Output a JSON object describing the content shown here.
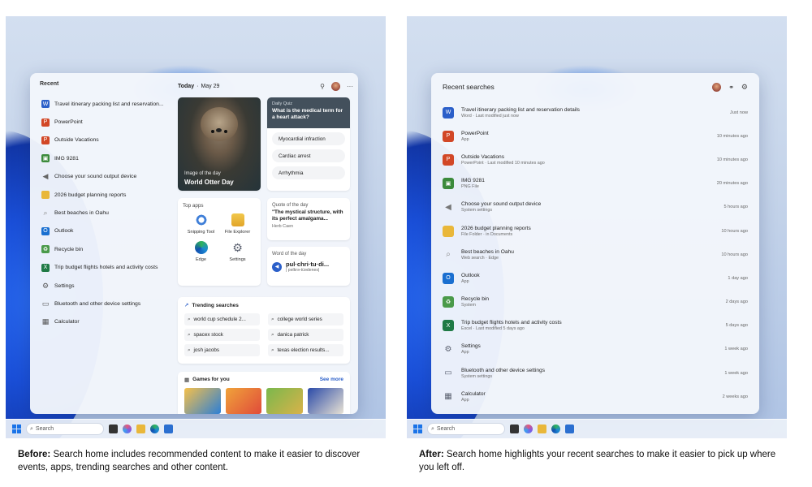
{
  "left": {
    "taskbar_search": "Search",
    "recent_header": "Recent",
    "recent": [
      {
        "label": "Travel itinerary packing list and reservation...",
        "icon": "word-icon",
        "color": "#2b5fc9"
      },
      {
        "label": "PowerPoint",
        "icon": "powerpoint-icon",
        "color": "#d24726"
      },
      {
        "label": "Outside Vacations",
        "icon": "powerpoint-file-icon",
        "color": "#d24726"
      },
      {
        "label": "IMG 9281",
        "icon": "image-thumbnail-icon",
        "color": "#3b8a3b"
      },
      {
        "label": "Choose your sound output device",
        "icon": "speaker-icon",
        "color": "#666666"
      },
      {
        "label": "2026 budget planning reports",
        "icon": "folder-icon",
        "color": "#e9b73a"
      },
      {
        "label": "Best beaches in Oahu",
        "icon": "search-icon",
        "color": "#888888"
      },
      {
        "label": "Outlook",
        "icon": "outlook-icon",
        "color": "#1a6fd0"
      },
      {
        "label": "Recycle bin",
        "icon": "recycle-bin-icon",
        "color": "#4a9a4a"
      },
      {
        "label": "Trip budget flights hotels and activity costs",
        "icon": "excel-icon",
        "color": "#1f7a45"
      },
      {
        "label": "Settings",
        "icon": "settings-icon",
        "color": "#555555"
      },
      {
        "label": "Bluetooth and other device settings",
        "icon": "bluetooth-devices-icon",
        "color": "#555555"
      },
      {
        "label": "Calculator",
        "icon": "calculator-icon",
        "color": "#555555"
      }
    ],
    "today": "Today",
    "date": "May 29",
    "image_of_day_label": "Image of the day",
    "image_of_day_title": "World Otter Day",
    "quiz_kicker": "Daily Quiz",
    "quiz_question": "What is the medical term for a heart attack?",
    "quiz_options": [
      "Myocardial infraction",
      "Cardiac arrest",
      "Arrhythmia"
    ],
    "top_apps_title": "Top apps",
    "top_apps": [
      {
        "label": "Snipping Tool",
        "color": "#3f7fd8"
      },
      {
        "label": "File Explorer",
        "color": "#e9b73a"
      },
      {
        "label": "Edge",
        "color": "#1b8ad4"
      },
      {
        "label": "Settings",
        "color": "#5b6170"
      }
    ],
    "quote_kicker": "Quote of the day",
    "quote_text": "\"The mystical structure, with its perfect amalgama...",
    "quote_author": "Herb Caen",
    "word_kicker": "Word of the day",
    "word": "pul·chri·tu·di...",
    "word_pron": "| pəlkrə-tüədenes|",
    "trending_title": "Trending searches",
    "trending": [
      "world cup schedule 2...",
      "college world series",
      "spacex stock",
      "danica patrick",
      "josh jacobs",
      "texas election results..."
    ],
    "games_title": "Games for you",
    "games_more": "See more",
    "caption_bold": "Before:",
    "caption_text": " Search home includes recommended content to make it easier to discover events, apps, trending searches and other content."
  },
  "right": {
    "taskbar_search": "Search",
    "header": "Recent searches",
    "items": [
      {
        "name": "Travel itinerary packing list and reservation details",
        "sub": "Word · Last modified just now",
        "time": "Just now",
        "icon": "word-icon",
        "color": "#2b5fc9"
      },
      {
        "name": "PowerPoint",
        "sub": "App",
        "time": "10 minutes ago",
        "icon": "powerpoint-icon",
        "color": "#d24726"
      },
      {
        "name": "Outside Vacations",
        "sub": "PowerPoint · Last modified 10 minutes ago",
        "time": "10 minutes ago",
        "icon": "powerpoint-file-icon",
        "color": "#d24726"
      },
      {
        "name": "IMG 9281",
        "sub": "PNG File",
        "time": "20 minutes ago",
        "icon": "image-thumbnail-icon",
        "color": "#3b8a3b"
      },
      {
        "name": "Choose your sound output device",
        "sub": "System settings",
        "time": "5 hours ago",
        "icon": "speaker-icon",
        "color": "#777777"
      },
      {
        "name": "2026 budget planning reports",
        "sub": "File Folder · in Documents",
        "time": "10 hours ago",
        "icon": "folder-icon",
        "color": "#e9b73a"
      },
      {
        "name": "Best beaches in Oahu",
        "sub": "Web search · Edge",
        "time": "10 hours ago",
        "icon": "search-icon",
        "color": "#888888"
      },
      {
        "name": "Outlook",
        "sub": "App",
        "time": "1 day ago",
        "icon": "outlook-icon",
        "color": "#1a6fd0"
      },
      {
        "name": "Recycle bin",
        "sub": "System",
        "time": "2 days ago",
        "icon": "recycle-bin-icon",
        "color": "#4a9a4a"
      },
      {
        "name": "Trip budget flights hotels and activity costs",
        "sub": "Excel · Last modified 5 days ago",
        "time": "5 days ago",
        "icon": "excel-icon",
        "color": "#1f7a45"
      },
      {
        "name": "Settings",
        "sub": "App",
        "time": "1 week ago",
        "icon": "settings-icon",
        "color": "#5b6170"
      },
      {
        "name": "Bluetooth and other device settings",
        "sub": "System settings",
        "time": "1 week ago",
        "icon": "bluetooth-devices-icon",
        "color": "#5b6170"
      },
      {
        "name": "Calculator",
        "sub": "App",
        "time": "2 weeks ago",
        "icon": "calculator-icon",
        "color": "#5b6170"
      }
    ],
    "caption_bold": "After:",
    "caption_text": " Search home highlights your recent searches to make it easier to pick up where you left off."
  }
}
